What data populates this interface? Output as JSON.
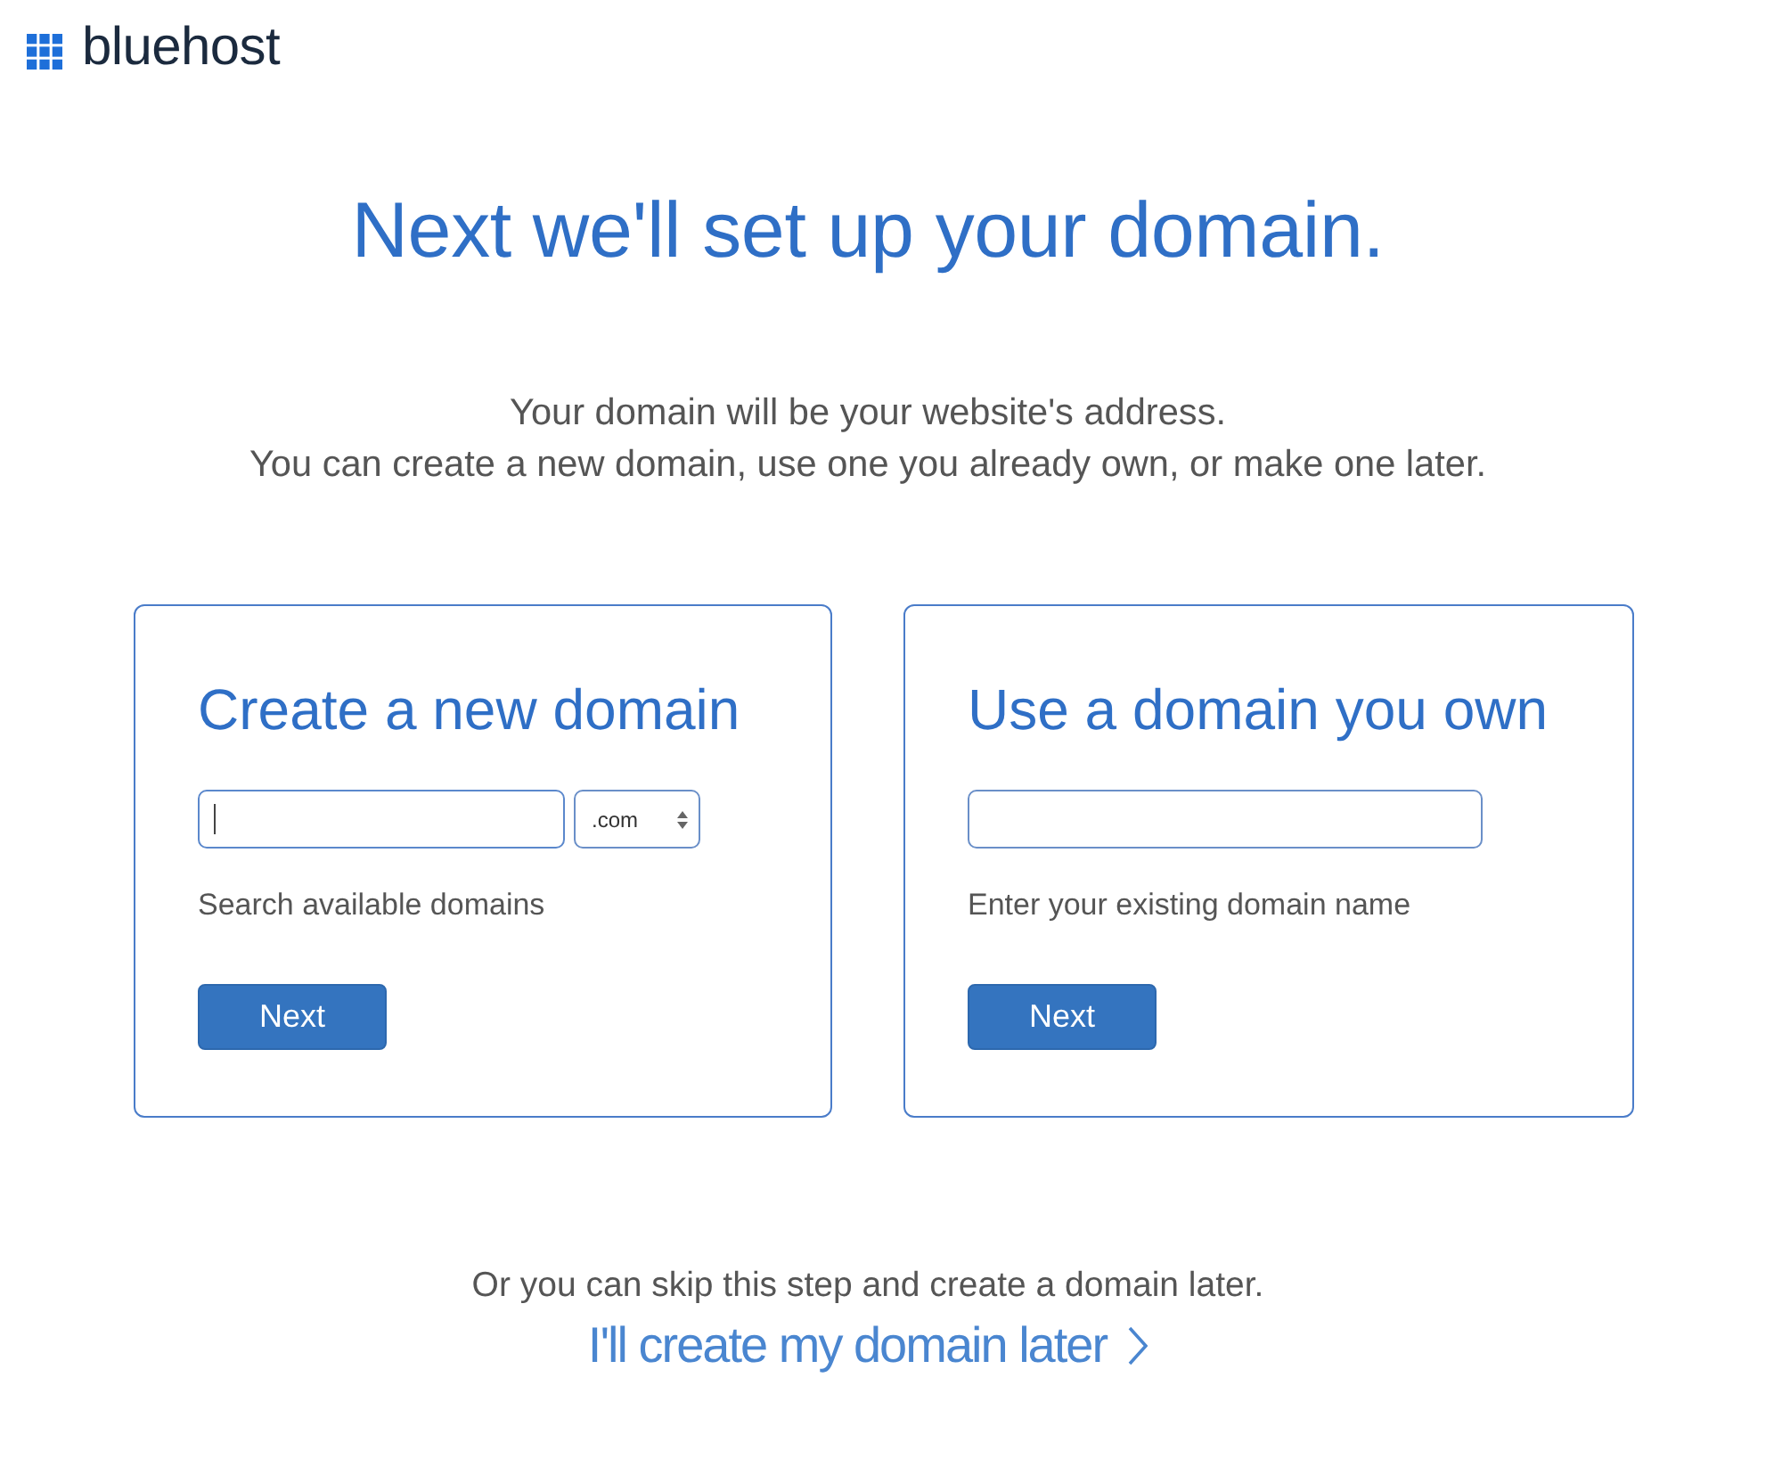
{
  "logo": {
    "text": "bluehost"
  },
  "heading": "Next we'll set up your domain.",
  "intro": [
    "Your domain will be your website's address.",
    "You can create a new domain, use one you already own, or make one later."
  ],
  "options": [
    {
      "kind": "search",
      "title": "Create a new domain",
      "input": {
        "focused": true
      },
      "select": {
        "value": ".com"
      },
      "hint": "Search available domains",
      "button": "Next"
    },
    {
      "kind": "existing",
      "title": "Use a domain you own",
      "input": {
        "focused": false
      },
      "hint": "Enter your existing domain name",
      "button": "Next"
    }
  ],
  "skip": {
    "text": "Or you can skip this step and create a domain later.",
    "link": "I'll create my domain later"
  }
}
